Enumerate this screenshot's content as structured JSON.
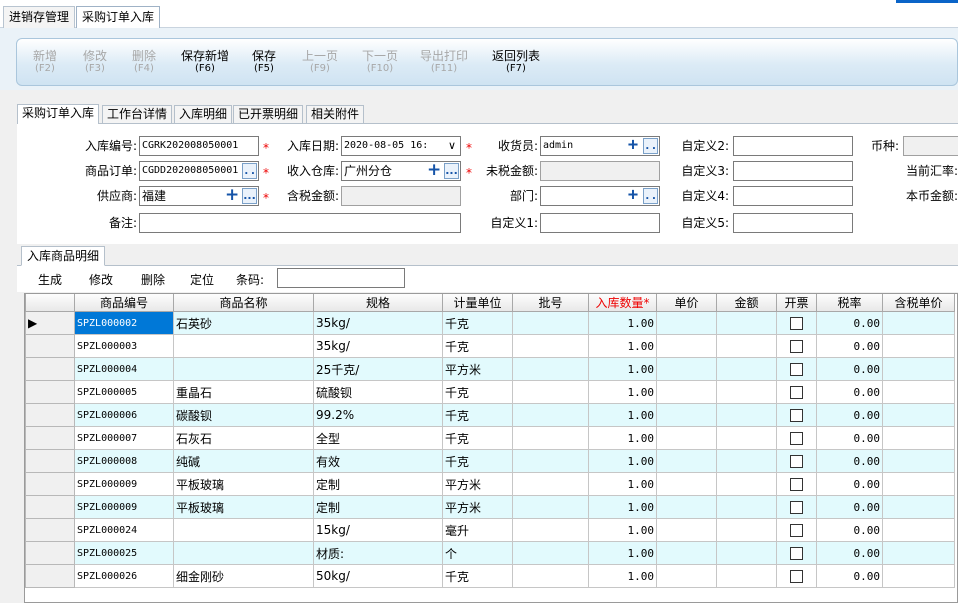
{
  "doc_tabs": [
    "进销存管理",
    "采购订单入库"
  ],
  "toolbar": [
    {
      "label": "新增",
      "key": "(F2)",
      "enabled": false
    },
    {
      "label": "修改",
      "key": "(F3)",
      "enabled": false
    },
    {
      "label": "删除",
      "key": "(F4)",
      "enabled": false
    },
    {
      "label": "保存新增",
      "key": "(F6)",
      "enabled": true
    },
    {
      "label": "保存",
      "key": "(F5)",
      "enabled": true
    },
    {
      "label": "上一页",
      "key": "(F9)",
      "enabled": false
    },
    {
      "label": "下一页",
      "key": "(F10)",
      "enabled": false
    },
    {
      "label": "导出打印",
      "key": "(F11)",
      "enabled": false
    },
    {
      "label": "返回列表",
      "key": "(F7)",
      "enabled": true
    }
  ],
  "sub_tabs": [
    "采购订单入库",
    "工作台详情",
    "入库明细",
    "已开票明细",
    "相关附件"
  ],
  "form": {
    "inbound_no_label": "入库编号:",
    "inbound_no": "CGRK202008050001",
    "order_label": "商品订单:",
    "order_no": "CGDD202008050001",
    "supplier_label": "供应商:",
    "supplier": "福建",
    "remark_label": "备注:",
    "remark": "",
    "date_label": "入库日期:",
    "date": "2020-08-05 16:",
    "warehouse_label": "收入仓库:",
    "warehouse": "广州分仓",
    "tax_amount_label": "含税金额:",
    "tax_amount": "",
    "receiver_label": "收货员:",
    "receiver": "admin",
    "pretax_label": "未税金额:",
    "pretax": "",
    "dept_label": "部门:",
    "dept": "",
    "custom1_label": "自定义1:",
    "custom1": "",
    "custom2_label": "自定义2:",
    "custom2": "",
    "custom3_label": "自定义3:",
    "custom3": "",
    "custom4_label": "自定义4:",
    "custom4": "",
    "custom5_label": "自定义5:",
    "custom5": "",
    "currency_label": "币种:",
    "currency": "",
    "rate_label": "当前汇率:",
    "local_amount_label": "本币金额:",
    "required_mark": "*",
    "dropdown_mark": "...",
    "plus_mark": "+",
    "chevron": "∨"
  },
  "detail_tab": "入库商品明细",
  "grid_toolbar": {
    "generate": "生成",
    "edit": "修改",
    "delete": "删除",
    "locate": "定位",
    "barcode_label": "条码:",
    "barcode": ""
  },
  "grid": {
    "headers": [
      "商品编号",
      "商品名称",
      "规格",
      "计量单位",
      "批号",
      "入库数量*",
      "单价",
      "金额",
      "开票",
      "税率",
      "含税单价"
    ],
    "rows": [
      {
        "code": "SPZL000002",
        "name": "石英砂",
        "spec": "35kg/",
        "unit": "千克",
        "batch": "",
        "qty": "1.00",
        "tax_rate": "0.00"
      },
      {
        "code": "SPZL000003",
        "name": "",
        "spec": "35kg/",
        "unit": "千克",
        "batch": "",
        "qty": "1.00",
        "tax_rate": "0.00"
      },
      {
        "code": "SPZL000004",
        "name": "",
        "spec": "25千克/",
        "unit": "平方米",
        "batch": "",
        "qty": "1.00",
        "tax_rate": "0.00"
      },
      {
        "code": "SPZL000005",
        "name": "重晶石",
        "spec": "硫酸钡",
        "unit": "千克",
        "batch": "",
        "qty": "1.00",
        "tax_rate": "0.00"
      },
      {
        "code": "SPZL000006",
        "name": "碳酸钡",
        "spec": "99.2%",
        "unit": "千克",
        "batch": "",
        "qty": "1.00",
        "tax_rate": "0.00"
      },
      {
        "code": "SPZL000007",
        "name": "石灰石",
        "spec": "全型",
        "unit": "千克",
        "batch": "",
        "qty": "1.00",
        "tax_rate": "0.00"
      },
      {
        "code": "SPZL000008",
        "name": "纯碱",
        "spec": "有效",
        "unit": "千克",
        "batch": "",
        "qty": "1.00",
        "tax_rate": "0.00"
      },
      {
        "code": "SPZL000009",
        "name": "平板玻璃",
        "spec": "定制",
        "unit": "平方米",
        "batch": "",
        "qty": "1.00",
        "tax_rate": "0.00"
      },
      {
        "code": "SPZL000009",
        "name": "平板玻璃",
        "spec": "定制",
        "unit": "平方米",
        "batch": "",
        "qty": "1.00",
        "tax_rate": "0.00"
      },
      {
        "code": "SPZL000024",
        "name": "",
        "spec": "15kg/",
        "unit": "毫升",
        "batch": "",
        "qty": "1.00",
        "tax_rate": "0.00"
      },
      {
        "code": "SPZL000025",
        "name": "",
        "spec": "材质:",
        "unit": "个",
        "batch": "",
        "qty": "1.00",
        "tax_rate": "0.00"
      },
      {
        "code": "SPZL000026",
        "name": "细金刚砂",
        "spec": "50kg/",
        "unit": "千克",
        "batch": "",
        "qty": "1.00",
        "tax_rate": "0.00"
      }
    ],
    "current_row_marker": "▶"
  }
}
